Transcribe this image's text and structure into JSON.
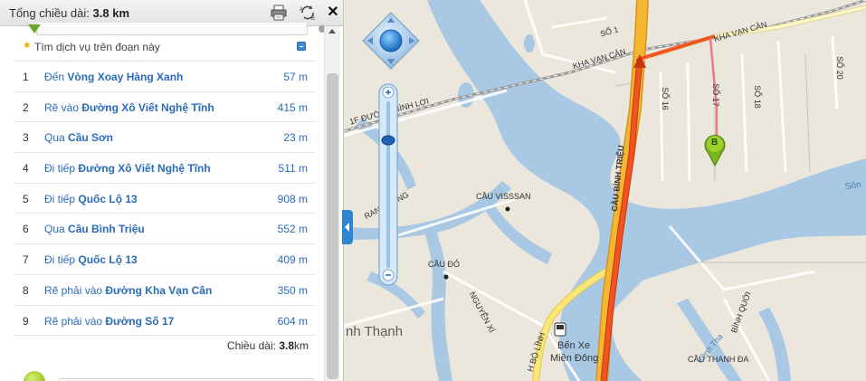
{
  "panel": {
    "total_label": "Tổng chiều dài:",
    "total_value": "3.8 km",
    "service_text": "Tìm dịch vụ trên đoạn này",
    "icons": [
      "print-icon",
      "ab-swap-icon",
      "close-icon"
    ]
  },
  "steps": [
    {
      "num": "1",
      "action": "Đến",
      "road": "Vòng Xoay Hàng Xanh",
      "dist": "57 m"
    },
    {
      "num": "2",
      "action": "Rẽ vào",
      "road": "Đường Xô Viết Nghệ Tĩnh",
      "dist": "415 m"
    },
    {
      "num": "3",
      "action": "Qua",
      "road": "Cầu Sơn",
      "dist": "23 m"
    },
    {
      "num": "4",
      "action": "Đi tiếp",
      "road": "Đường Xô Viết Nghệ Tĩnh",
      "dist": "511 m"
    },
    {
      "num": "5",
      "action": "Đi tiếp",
      "road": "Quốc Lộ 13",
      "dist": "908 m"
    },
    {
      "num": "6",
      "action": "Qua",
      "road": "Cầu Bình Triệu",
      "dist": "552 m"
    },
    {
      "num": "7",
      "action": "Đi tiếp",
      "road": "Quốc Lộ 13",
      "dist": "409 m"
    },
    {
      "num": "8",
      "action": "Rẽ phải vào",
      "road": "Đường Kha Vạn Cân",
      "dist": "350 m"
    },
    {
      "num": "9",
      "action": "Rẽ phải vào",
      "road": "Đường Số 17",
      "dist": "604 m"
    }
  ],
  "summary": {
    "label": "Chiều dài:",
    "value": "3.8",
    "unit": "km"
  },
  "map": {
    "labels": {
      "so1": "SỐ 1",
      "kvc1": "KHA VẠN CÂN",
      "kvc2": "KHA VẠN CÂN",
      "so20": "SỐ 20",
      "so16": "SỐ 16",
      "so17": "SỐ 17",
      "so18": "SỐ 18",
      "binhloi": "1F ĐƯỜNG BÌNH LỢI",
      "caubinhtrieu": "CẦU BÌNH TRIỆU",
      "cauvisssan": "CẦU VISSSAN",
      "trangiong": "RANG LONG",
      "caudo": "CẦU ĐỎ",
      "nguyenxi": "NGUYỄN XÍ",
      "binhthanh": "nh Thạnh",
      "benxe1": "Bến Xe",
      "benxe2": "Miền Đông",
      "boline": "H BỘ LĨNH",
      "binhquoi": "BÌNH QUỚI",
      "cauthanhda": "CẦU THANH ĐA",
      "kenh": "Kênh Tha",
      "song": "Sôn",
      "marker_b": "B"
    },
    "colors": {
      "water": "#a9c8e3",
      "land": "#ebe7dd",
      "route": "#f0551f",
      "highway": "#f5b732",
      "secondary_road": "#fbe67a"
    }
  }
}
